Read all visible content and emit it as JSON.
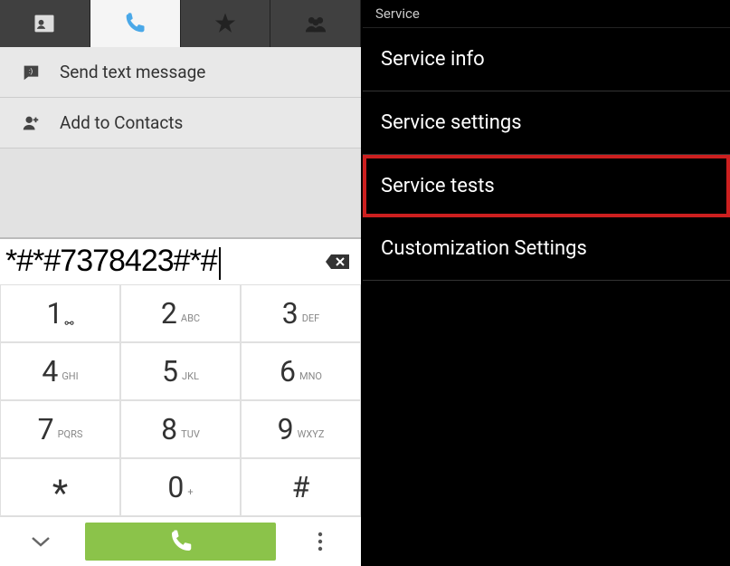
{
  "left": {
    "tabs": [
      "contacts",
      "dialer",
      "favorites",
      "groups"
    ],
    "active_tab": 1,
    "actions": {
      "sms": "Send text message",
      "add_contact": "Add to Contacts"
    },
    "dial_number": "*#*#7378423#*#",
    "keypad": [
      {
        "digit": "1",
        "letters": ""
      },
      {
        "digit": "2",
        "letters": "ABC"
      },
      {
        "digit": "3",
        "letters": "DEF"
      },
      {
        "digit": "4",
        "letters": "GHI"
      },
      {
        "digit": "5",
        "letters": "JKL"
      },
      {
        "digit": "6",
        "letters": "MNO"
      },
      {
        "digit": "7",
        "letters": "PQRS"
      },
      {
        "digit": "8",
        "letters": "TUV"
      },
      {
        "digit": "9",
        "letters": "WXYZ"
      },
      {
        "digit": "*",
        "letters": ""
      },
      {
        "digit": "0",
        "letters": "+"
      },
      {
        "digit": "#",
        "letters": ""
      }
    ]
  },
  "right": {
    "header": "Service",
    "items": [
      {
        "label": "Service info",
        "highlighted": false
      },
      {
        "label": "Service settings",
        "highlighted": false
      },
      {
        "label": "Service tests",
        "highlighted": true
      },
      {
        "label": "Customization Settings",
        "highlighted": false
      }
    ]
  }
}
